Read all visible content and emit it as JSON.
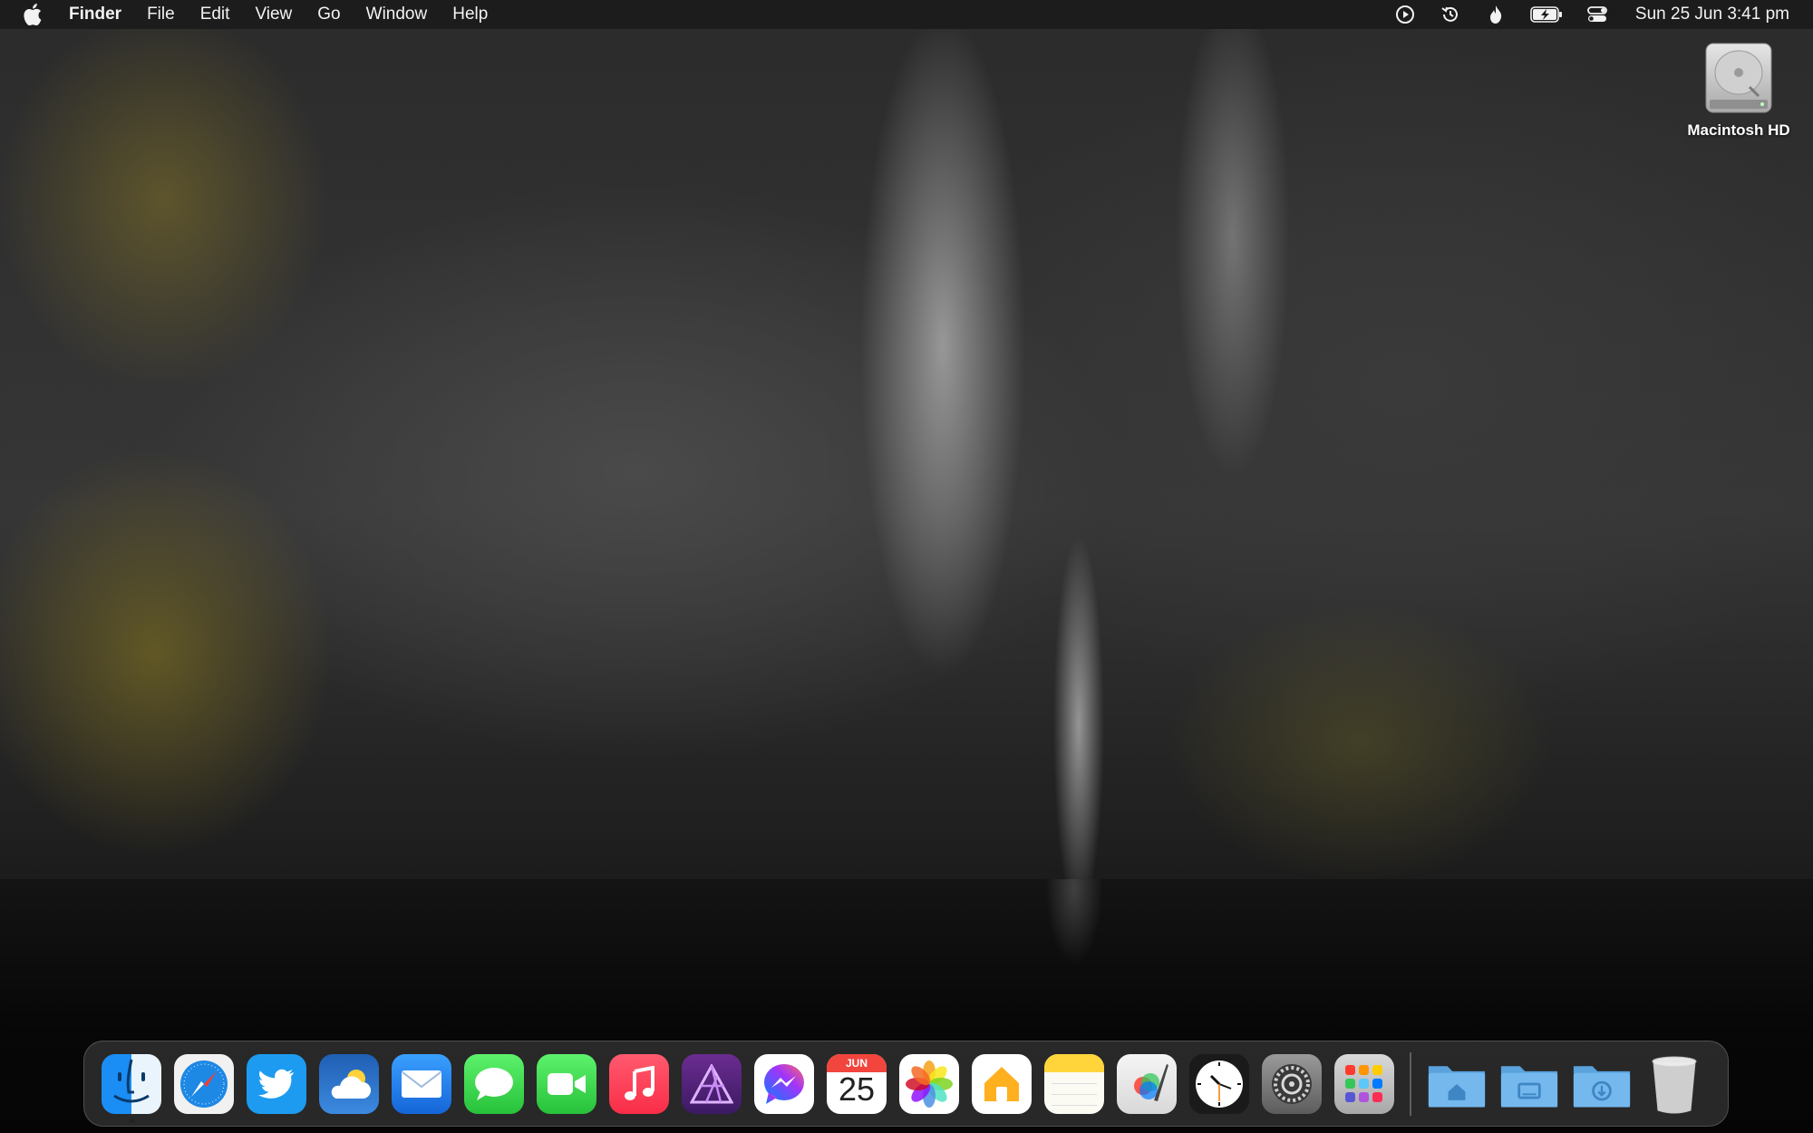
{
  "menubar": {
    "app_name": "Finder",
    "menus": [
      "File",
      "Edit",
      "View",
      "Go",
      "Window",
      "Help"
    ],
    "status_icons": [
      "play-circle-icon",
      "time-machine-icon",
      "flame-icon",
      "battery-charging-icon",
      "control-center-icon"
    ],
    "datetime": "Sun 25 Jun  3:41 pm"
  },
  "desktop": {
    "drive_label": "Macintosh HD"
  },
  "dock": {
    "apps": [
      {
        "name": "Finder",
        "icon": "finder-icon",
        "running": true
      },
      {
        "name": "Safari",
        "icon": "safari-icon"
      },
      {
        "name": "Twitter",
        "icon": "twitter-icon"
      },
      {
        "name": "Weather",
        "icon": "weather-icon"
      },
      {
        "name": "Mail",
        "icon": "mail-icon"
      },
      {
        "name": "Messages",
        "icon": "messages-icon"
      },
      {
        "name": "FaceTime",
        "icon": "facetime-icon"
      },
      {
        "name": "Music",
        "icon": "music-icon"
      },
      {
        "name": "Affinity",
        "icon": "affinity-icon"
      },
      {
        "name": "Messenger",
        "icon": "messenger-icon"
      },
      {
        "name": "Calendar",
        "icon": "calendar-icon",
        "month": "JUN",
        "day": "25"
      },
      {
        "name": "Photos",
        "icon": "photos-icon"
      },
      {
        "name": "Home",
        "icon": "home-icon"
      },
      {
        "name": "Notes",
        "icon": "notes-icon"
      },
      {
        "name": "Pixelmator",
        "icon": "pixelmator-icon"
      },
      {
        "name": "Clock",
        "icon": "clock-icon"
      },
      {
        "name": "System Settings",
        "icon": "settings-icon"
      },
      {
        "name": "Launchpad",
        "icon": "launchpad-icon"
      }
    ],
    "folders": [
      {
        "name": "Home folder",
        "icon": "home-folder-icon"
      },
      {
        "name": "Desktop folder",
        "icon": "desktop-folder-icon"
      },
      {
        "name": "Downloads folder",
        "icon": "downloads-folder-icon"
      },
      {
        "name": "Trash",
        "icon": "trash-icon"
      }
    ]
  },
  "colors": {
    "menubar_bg": "#1c1c1c",
    "folder_blue": "#6fb3e8"
  }
}
